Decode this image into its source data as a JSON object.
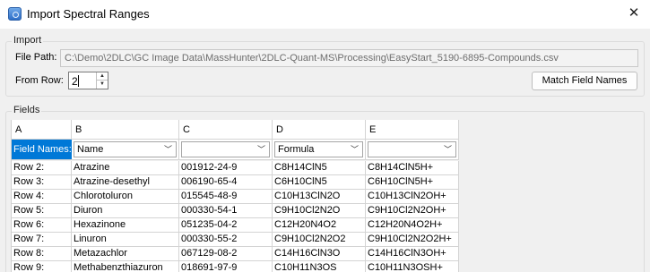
{
  "window": {
    "title": "Import Spectral Ranges",
    "close_glyph": "✕"
  },
  "import_group": {
    "label": "Import",
    "file_path_label": "File Path:",
    "file_path_value": "C:\\Demo\\2DLC\\GC Image Data\\MassHunter\\2DLC-Quant-MS\\Processing\\EasyStart_5190-6895-Compounds.csv",
    "from_row_label": "From Row:",
    "from_row_value": "2",
    "match_button": "Match Field Names"
  },
  "fields_group": {
    "label": "Fields",
    "column_letters": [
      "A",
      "B",
      "C",
      "D",
      "E"
    ],
    "field_names_label": "Field Names:",
    "field_selections": [
      "Name",
      "",
      "Formula",
      ""
    ],
    "rows": [
      [
        "Row 2:",
        "Atrazine",
        "001912-24-9",
        "C8H14ClN5",
        "C8H14ClN5H+"
      ],
      [
        "Row 3:",
        "Atrazine-desethyl",
        "006190-65-4",
        "C6H10ClN5",
        "C6H10ClN5H+"
      ],
      [
        "Row 4:",
        "Chlorotoluron",
        "015545-48-9",
        "C10H13ClN2O",
        "C10H13ClN2OH+"
      ],
      [
        "Row 5:",
        "Diuron",
        "000330-54-1",
        "C9H10Cl2N2O",
        "C9H10Cl2N2OH+"
      ],
      [
        "Row 6:",
        "Hexazinone",
        "051235-04-2",
        "C12H20N4O2",
        "C12H20N4O2H+"
      ],
      [
        "Row 7:",
        "Linuron",
        "000330-55-2",
        "C9H10Cl2N2O2",
        "C9H10Cl2N2O2H+"
      ],
      [
        "Row 8:",
        "Metazachlor",
        "067129-08-2",
        "C14H16ClN3O",
        "C14H16ClN3OH+"
      ],
      [
        "Row 9:",
        "Methabenzthiazuron",
        "018691-97-9",
        "C10H11N3OS",
        "C10H11N3OSH+"
      ]
    ]
  }
}
